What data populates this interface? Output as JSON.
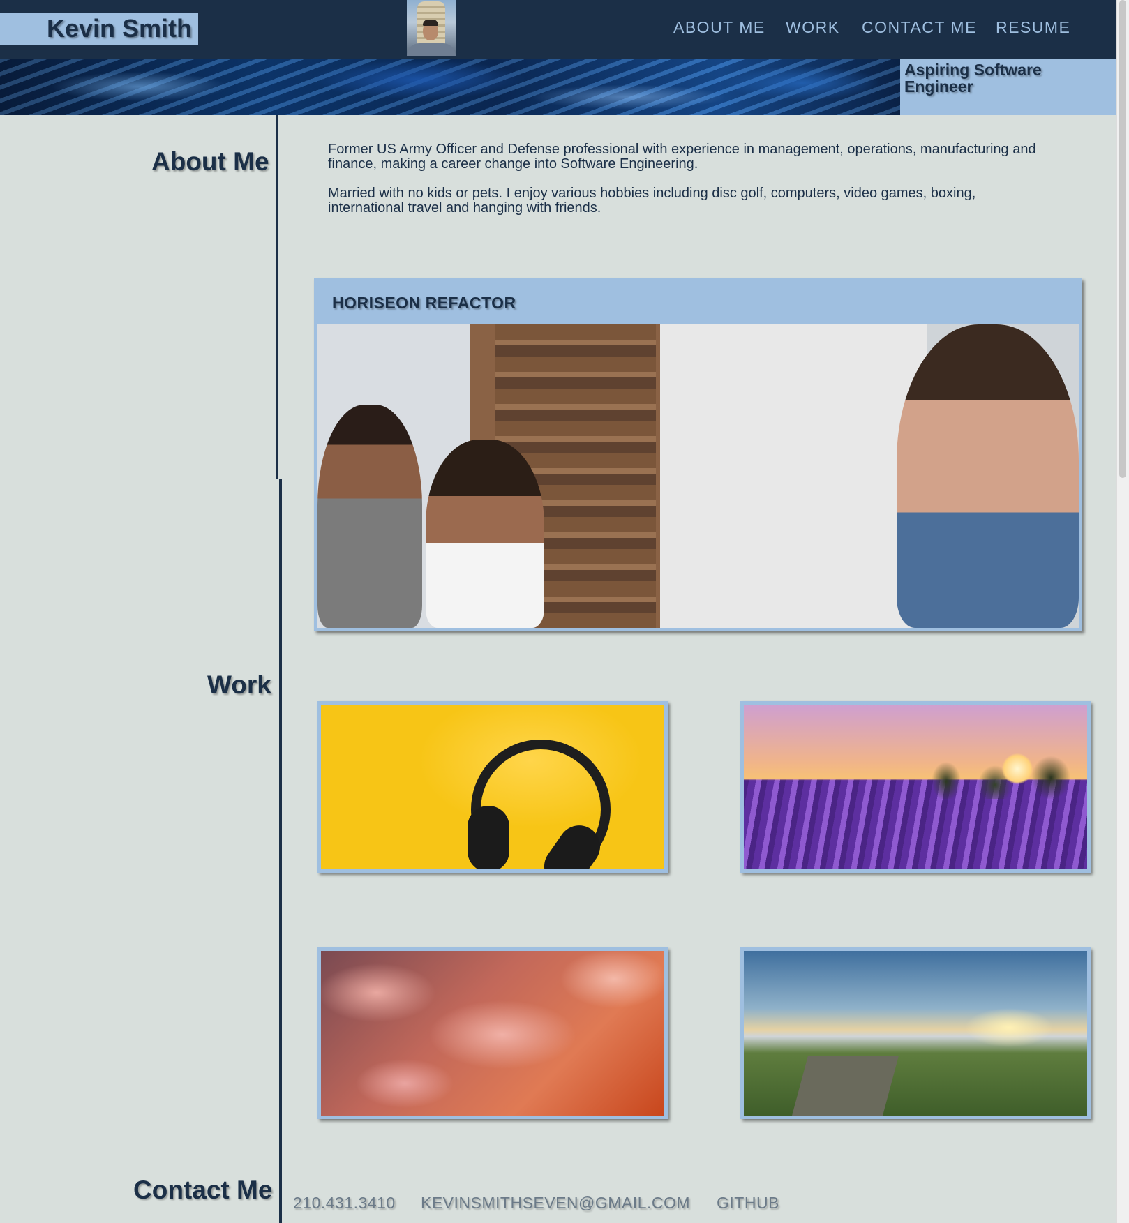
{
  "header": {
    "name": "Kevin Smith",
    "nav": [
      "ABOUT ME",
      "WORK",
      "CONTACT ME",
      "RESUME"
    ]
  },
  "banner": {
    "tagline": "Aspiring Software Engineer"
  },
  "about": {
    "title": "About Me",
    "paragraphs": [
      "Former US Army Officer and Defense professional with experience in management, operations, manufacturing and finance, making a career change into Software Engineering.",
      "Married with no kids or pets. I enjoy various hobbies including disc golf, computers, video games, boxing, international travel and hanging with friends."
    ]
  },
  "work": {
    "title": "Work",
    "featured_title": "HORISEON REFACTOR"
  },
  "contact": {
    "title": "Contact Me",
    "phone": "210.431.3410",
    "email": "KEVINSMITHSEVEN@GMAIL.COM",
    "github": "GITHUB"
  },
  "colors": {
    "navy": "#1b2f47",
    "accent_blue": "#9fbfe0",
    "page_background": "#d8dfdc"
  }
}
